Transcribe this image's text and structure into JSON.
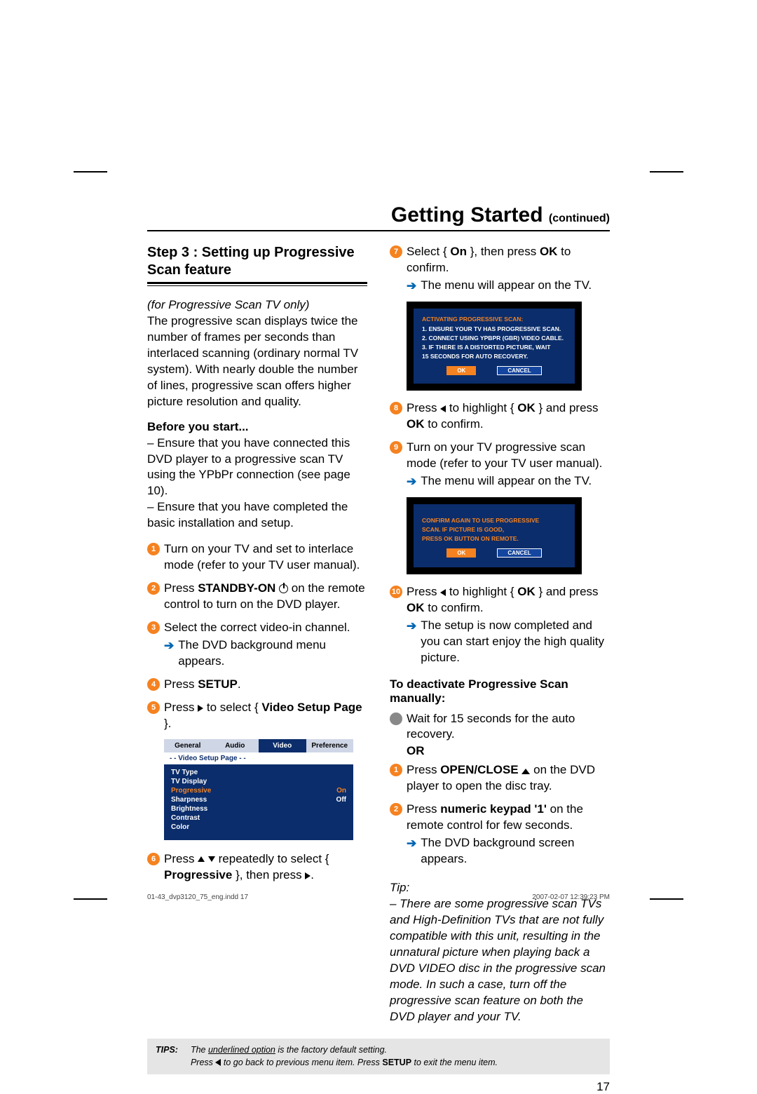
{
  "header": {
    "title": "Getting Started",
    "continued": "(continued)"
  },
  "stepTitle": "Step 3 : Setting up Progressive Scan feature",
  "note": "(for Progressive Scan TV only)",
  "introPara": "The progressive scan displays twice the number of frames per seconds than interlaced scanning (ordinary normal TV system). With nearly double the number of lines, progressive scan offers higher picture resolution and quality.",
  "before": {
    "head": "Before you start...",
    "l1": "– Ensure that you have connected this DVD player to a progressive scan TV using the YPbPr connection (see page 10).",
    "l2": "– Ensure that you have completed the basic installation and setup."
  },
  "leftSteps": {
    "s1": "Turn on your TV and set to interlace mode (refer to your TV user manual).",
    "s2a": "Press ",
    "s2b": "STANDBY-ON",
    "s2c": " on the remote control to turn on the DVD player.",
    "s3": "Select the correct video-in channel.",
    "s3sub": "The DVD background menu appears.",
    "s4a": "Press ",
    "s4b": "SETUP",
    "s4c": ".",
    "s5a": "Press ",
    "s5b": " to select { ",
    "s5c": "Video Setup Page",
    "s5d": " }.",
    "s6a": "Press ",
    "s6b": " repeatedly to select { ",
    "s6c": "Progressive",
    "s6d": " }, then press "
  },
  "menu": {
    "tabs": [
      "General",
      "Audio",
      "Video",
      "Preference"
    ],
    "strip": "- -   Video Setup Page   - -",
    "rows": [
      {
        "label": "TV Type",
        "value": ""
      },
      {
        "label": "TV Display",
        "value": ""
      },
      {
        "label": "Progressive",
        "value": "On",
        "selected": true
      },
      {
        "label": "Sharpness",
        "value": "Off"
      },
      {
        "label": "Brightness",
        "value": ""
      },
      {
        "label": "Contrast",
        "value": ""
      },
      {
        "label": "Color",
        "value": ""
      }
    ]
  },
  "rightSteps": {
    "s7a": "Select { ",
    "s7b": "On",
    "s7c": " }, then press ",
    "s7d": "OK",
    "s7e": " to confirm.",
    "s7sub": "The menu will appear on the TV.",
    "s8a": "Press ",
    "s8b": " to highlight { ",
    "s8c": "OK",
    "s8d": " } and press ",
    "s8e": "OK",
    "s8f": " to confirm.",
    "s9a": "Turn on your TV progressive scan mode (refer to your TV user manual).",
    "s9sub": "The menu will appear on the TV.",
    "s10a": "Press ",
    "s10b": " to highlight { ",
    "s10c": "OK",
    "s10d": " } and press ",
    "s10e": "OK",
    "s10f": " to confirm.",
    "s10sub": "The setup is now completed and you can start enjoy the high quality picture."
  },
  "dialog1": {
    "title": "ACTIVATING PROGRESSIVE SCAN:",
    "l1": "1. ENSURE YOUR TV HAS PROGRESSIVE SCAN.",
    "l2": "2. CONNECT USING YPBPR (GBR) VIDEO CABLE.",
    "l3": "3. IF THERE IS A DISTORTED PICTURE, WAIT",
    "l4": "    15 SECONDS FOR AUTO RECOVERY.",
    "ok": "OK",
    "cancel": "CANCEL"
  },
  "dialog2": {
    "l1": "CONFIRM AGAIN TO USE PROGRESSIVE",
    "l2": "SCAN. IF PICTURE IS GOOD,",
    "l3": "PRESS OK BUTTON ON REMOTE.",
    "ok": "OK",
    "cancel": "CANCEL"
  },
  "deactivate": {
    "head": "To deactivate Progressive Scan manually:",
    "bullet": "Wait for 15 seconds for the auto recovery.",
    "or": "OR",
    "s1a": "Press ",
    "s1b": "OPEN/CLOSE",
    "s1c": " on the DVD player to open the disc tray.",
    "s2a": "Press ",
    "s2b": "numeric keypad '1'",
    "s2c": " on the remote control for few seconds.",
    "s2sub": "The DVD background screen appears."
  },
  "tip": {
    "head": "Tip:",
    "body": "– There are some progressive scan TVs and High-Definition TVs that are not fully compatible with this unit, resulting in the unnatural picture when playing back a DVD VIDEO disc in the progressive scan mode. In such a case, turn off the progressive scan feature on both the DVD player and your TV."
  },
  "tipsBox": {
    "label": "TIPS:",
    "l1a": "The ",
    "l1b": "underlined option",
    "l1c": " is the factory default setting.",
    "l2a": "Press ",
    "l2b": " to go back to previous menu item. Press ",
    "l2c": "SETUP",
    "l2d": " to exit the menu item."
  },
  "pageNumber": "17",
  "footer": {
    "left": "01-43_dvp3120_75_eng.indd   17",
    "right": "2007-02-07   12:39:23 PM"
  }
}
